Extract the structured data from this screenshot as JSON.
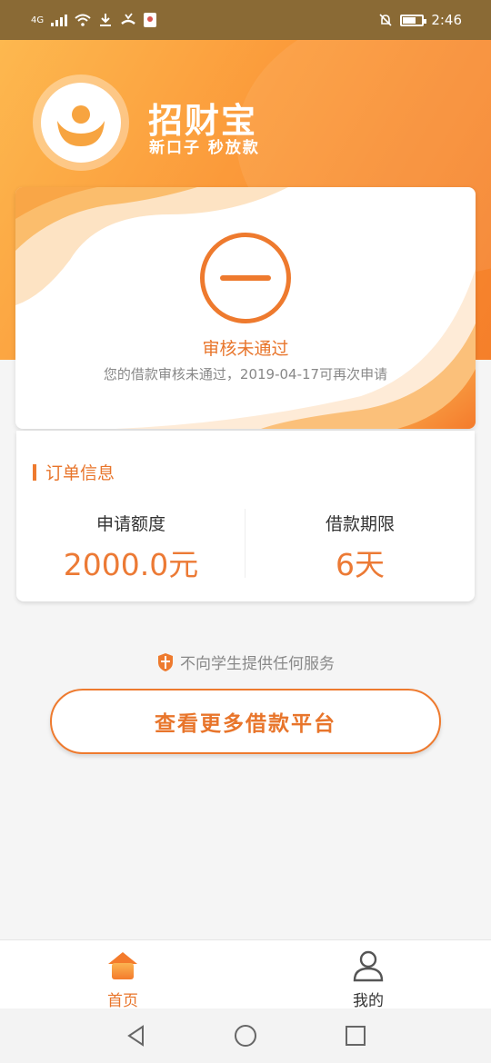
{
  "status_bar": {
    "network": "4G",
    "time": "2:46"
  },
  "brand": {
    "name": "招财宝",
    "slogan": "新口子 秒放款"
  },
  "review": {
    "title": "审核未通过",
    "description": "您的借款审核未通过，2019-04-17可再次申请"
  },
  "order": {
    "section_title": "订单信息",
    "amount_label": "申请额度",
    "amount_value": "2000.0元",
    "term_label": "借款期限",
    "term_value": "6天"
  },
  "notice": "不向学生提供任何服务",
  "more_button": "查看更多借款平台",
  "tabs": [
    {
      "label": "首页",
      "icon": "home-icon",
      "active": true
    },
    {
      "label": "我的",
      "icon": "user-icon",
      "active": false
    }
  ],
  "colors": {
    "accent": "#ee7a2e",
    "header_start": "#fdb84f",
    "header_end": "#f57f2a"
  }
}
